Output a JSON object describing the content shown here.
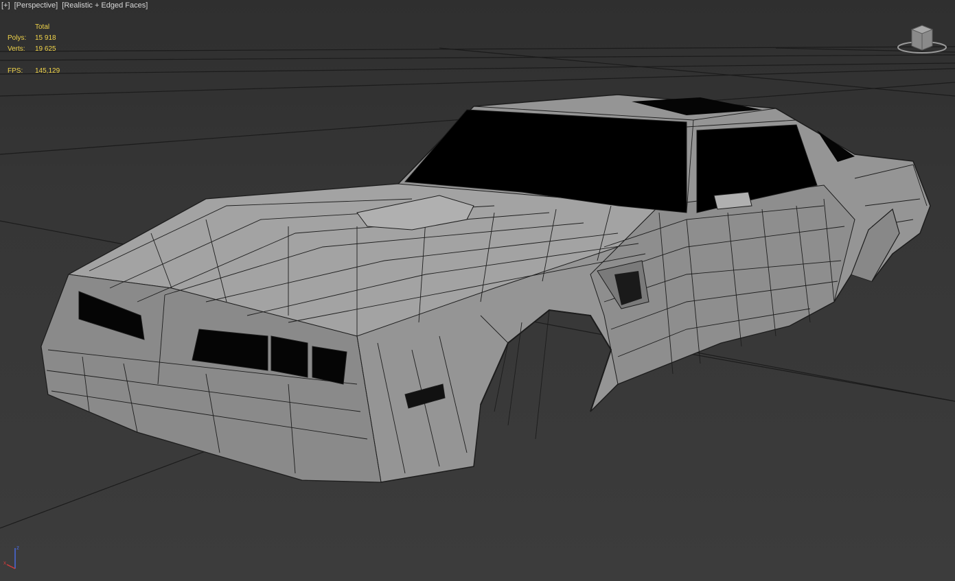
{
  "viewport": {
    "menu": {
      "plus": "[+]",
      "view": "[Perspective]",
      "shading": "[Realistic + Edged Faces]"
    },
    "stats": {
      "header": "Total",
      "polys_label": "Polys:",
      "polys_value": "15 918",
      "verts_label": "Verts:",
      "verts_value": "19 625",
      "fps_label": "FPS:",
      "fps_value": "145,129"
    },
    "viewcube_icon": "viewcube-icon",
    "axis": {
      "x": "x",
      "z": "z"
    }
  },
  "colors": {
    "background": "#3b3b3b",
    "stats_text": "#f1d44a",
    "menu_text": "#d8d8d8",
    "grid_line": "#1a1a1a",
    "mesh_face": "#9a9a9a",
    "mesh_edge": "#1c1c1c",
    "glass": "#000000",
    "axis_x": "#d23c3c",
    "axis_z": "#4a6ae0"
  }
}
